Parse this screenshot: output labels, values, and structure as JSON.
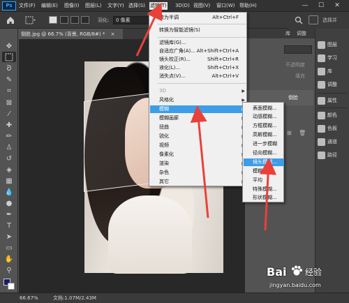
{
  "menubar": {
    "logo": "Ps",
    "items": [
      "文件(F)",
      "编辑(E)",
      "图像(I)",
      "图层(L)",
      "文字(Y)",
      "选择(S)",
      "滤镜(T)",
      "3D(D)",
      "视图(V)",
      "窗口(W)",
      "帮助(H)"
    ],
    "active_index": 6,
    "window_controls": [
      "—",
      "☐",
      "✕"
    ]
  },
  "options": {
    "feather_label": "羽化:",
    "feather_value": "0 像素",
    "select_and_mask": "选择并遮",
    "right_label": "选择并"
  },
  "document": {
    "tab_title": "倒脸.jpg @ 66.7% (背景, RGB/8#) *",
    "tab_close": "×"
  },
  "filter_menu": {
    "items": [
      {
        "label": "转为半调",
        "shortcut": "Alt+Ctrl+F",
        "arrow": false,
        "dim": false,
        "hl": false
      },
      {
        "label": "转换为智能滤镜(S)",
        "shortcut": "",
        "arrow": false,
        "dim": false,
        "hl": false
      },
      {
        "label": "滤镜库(G)...",
        "shortcut": "",
        "arrow": false,
        "dim": false,
        "hl": false
      },
      {
        "label": "自适应广角(A)...",
        "shortcut": "Alt+Shift+Ctrl+A",
        "arrow": false,
        "dim": false,
        "hl": false
      },
      {
        "label": "镜头校正(R)...",
        "shortcut": "Shift+Ctrl+R",
        "arrow": false,
        "dim": false,
        "hl": false
      },
      {
        "label": "液化(L)...",
        "shortcut": "Shift+Ctrl+X",
        "arrow": false,
        "dim": false,
        "hl": false
      },
      {
        "label": "消失点(V)...",
        "shortcut": "Alt+Ctrl+V",
        "arrow": false,
        "dim": false,
        "hl": false
      },
      {
        "label": "3D",
        "shortcut": "",
        "arrow": true,
        "dim": true,
        "hl": false
      },
      {
        "label": "风格化",
        "shortcut": "",
        "arrow": true,
        "dim": false,
        "hl": false
      },
      {
        "label": "模糊",
        "shortcut": "",
        "arrow": true,
        "dim": false,
        "hl": true
      },
      {
        "label": "模糊画廊",
        "shortcut": "",
        "arrow": true,
        "dim": false,
        "hl": false
      },
      {
        "label": "扭曲",
        "shortcut": "",
        "arrow": true,
        "dim": false,
        "hl": false
      },
      {
        "label": "锐化",
        "shortcut": "",
        "arrow": true,
        "dim": false,
        "hl": false
      },
      {
        "label": "视频",
        "shortcut": "",
        "arrow": true,
        "dim": false,
        "hl": false
      },
      {
        "label": "像素化",
        "shortcut": "",
        "arrow": true,
        "dim": false,
        "hl": false
      },
      {
        "label": "渲染",
        "shortcut": "",
        "arrow": true,
        "dim": false,
        "hl": false
      },
      {
        "label": "杂色",
        "shortcut": "",
        "arrow": true,
        "dim": false,
        "hl": false
      },
      {
        "label": "其它",
        "shortcut": "",
        "arrow": true,
        "dim": false,
        "hl": false
      }
    ]
  },
  "blur_menu": {
    "items": [
      "表面模糊...",
      "动感模糊...",
      "方框模糊...",
      "高斯模糊...",
      "进一步模糊",
      "径向模糊...",
      "镜头模糊...",
      "模糊",
      "平均",
      "特殊模糊...",
      "形状模糊..."
    ],
    "highlight_index": 6
  },
  "panels": {
    "tabs_top": [
      "库",
      "调整"
    ],
    "opacity_label": "不透明度",
    "fill_label": "填充",
    "layer_name": "倒脸",
    "dock_items": [
      "图层",
      "学习",
      "库",
      "调整",
      "属性",
      "颜色",
      "色板",
      "通道",
      "路径"
    ]
  },
  "statusbar": {
    "zoom": "66.67%",
    "doc_info": "文档:1.07M/2.43M"
  },
  "watermark": {
    "brand": "Bai",
    "brand2": "经验",
    "url": "jingyan.baidu.com"
  },
  "colors": {
    "menu_highlight": "#3d9de6",
    "annotation_arrow": "#e8413a",
    "ps_blue": "#31a8ff"
  },
  "icons": [
    "home-icon",
    "marquee-icon",
    "move-icon",
    "lasso-icon",
    "crop-icon",
    "eyedropper-icon",
    "brush-icon",
    "stamp-icon",
    "eraser-icon",
    "gradient-icon",
    "pen-icon",
    "text-icon",
    "zoom-icon",
    "hand-icon"
  ]
}
